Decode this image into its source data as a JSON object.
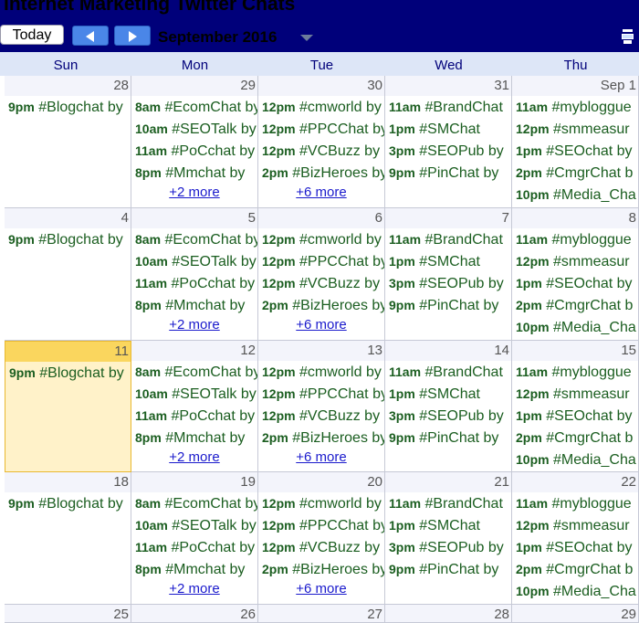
{
  "calendar": {
    "title": "Internet Marketing Twitter Chats",
    "today_label": "Today",
    "month_label": "September 2016",
    "day_names": [
      "Sun",
      "Mon",
      "Tue",
      "Wed",
      "Thu"
    ]
  },
  "weeks": [
    {
      "days": [
        {
          "num": "28",
          "today": false,
          "events": [
            {
              "time": "9pm",
              "title": "#Blogchat by"
            }
          ],
          "more": ""
        },
        {
          "num": "29",
          "today": false,
          "events": [
            {
              "time": "8am",
              "title": "#EcomChat by"
            },
            {
              "time": "10am",
              "title": "#SEOTalk by"
            },
            {
              "time": "11am",
              "title": "#PoCchat by"
            },
            {
              "time": "8pm",
              "title": "#Mmchat by"
            }
          ],
          "more": "+2 more"
        },
        {
          "num": "30",
          "today": false,
          "events": [
            {
              "time": "12pm",
              "title": "#cmworld by"
            },
            {
              "time": "12pm",
              "title": "#PPCChat by"
            },
            {
              "time": "12pm",
              "title": "#VCBuzz by"
            },
            {
              "time": "2pm",
              "title": "#BizHeroes by"
            }
          ],
          "more": "+6 more"
        },
        {
          "num": "31",
          "today": false,
          "events": [
            {
              "time": "11am",
              "title": "#BrandChat"
            },
            {
              "time": "1pm",
              "title": "#SMChat"
            },
            {
              "time": "3pm",
              "title": "#SEOPub by"
            },
            {
              "time": "9pm",
              "title": "#PinChat by"
            }
          ],
          "more": ""
        },
        {
          "num": "Sep 1",
          "today": false,
          "events": [
            {
              "time": "11am",
              "title": "#mybloggue"
            },
            {
              "time": "12pm",
              "title": "#smmeasur"
            },
            {
              "time": "1pm",
              "title": "#SEOchat by"
            },
            {
              "time": "2pm",
              "title": "#CmgrChat b"
            },
            {
              "time": "10pm",
              "title": "#Media_Cha"
            }
          ],
          "more": ""
        }
      ]
    },
    {
      "days": [
        {
          "num": "4",
          "today": false,
          "events": [
            {
              "time": "9pm",
              "title": "#Blogchat by"
            }
          ],
          "more": ""
        },
        {
          "num": "5",
          "today": false,
          "events": [
            {
              "time": "8am",
              "title": "#EcomChat by"
            },
            {
              "time": "10am",
              "title": "#SEOTalk by"
            },
            {
              "time": "11am",
              "title": "#PoCchat by"
            },
            {
              "time": "8pm",
              "title": "#Mmchat by"
            }
          ],
          "more": "+2 more"
        },
        {
          "num": "6",
          "today": false,
          "events": [
            {
              "time": "12pm",
              "title": "#cmworld by"
            },
            {
              "time": "12pm",
              "title": "#PPCChat by"
            },
            {
              "time": "12pm",
              "title": "#VCBuzz by"
            },
            {
              "time": "2pm",
              "title": "#BizHeroes by"
            }
          ],
          "more": "+6 more"
        },
        {
          "num": "7",
          "today": false,
          "events": [
            {
              "time": "11am",
              "title": "#BrandChat"
            },
            {
              "time": "1pm",
              "title": "#SMChat"
            },
            {
              "time": "3pm",
              "title": "#SEOPub by"
            },
            {
              "time": "9pm",
              "title": "#PinChat by"
            }
          ],
          "more": ""
        },
        {
          "num": "8",
          "today": false,
          "events": [
            {
              "time": "11am",
              "title": "#mybloggue"
            },
            {
              "time": "12pm",
              "title": "#smmeasur"
            },
            {
              "time": "1pm",
              "title": "#SEOchat by"
            },
            {
              "time": "2pm",
              "title": "#CmgrChat b"
            },
            {
              "time": "10pm",
              "title": "#Media_Cha"
            }
          ],
          "more": ""
        }
      ]
    },
    {
      "days": [
        {
          "num": "11",
          "today": true,
          "events": [
            {
              "time": "9pm",
              "title": "#Blogchat by"
            }
          ],
          "more": ""
        },
        {
          "num": "12",
          "today": false,
          "events": [
            {
              "time": "8am",
              "title": "#EcomChat by"
            },
            {
              "time": "10am",
              "title": "#SEOTalk by"
            },
            {
              "time": "11am",
              "title": "#PoCchat by"
            },
            {
              "time": "8pm",
              "title": "#Mmchat by"
            }
          ],
          "more": "+2 more"
        },
        {
          "num": "13",
          "today": false,
          "events": [
            {
              "time": "12pm",
              "title": "#cmworld by"
            },
            {
              "time": "12pm",
              "title": "#PPCChat by"
            },
            {
              "time": "12pm",
              "title": "#VCBuzz by"
            },
            {
              "time": "2pm",
              "title": "#BizHeroes by"
            }
          ],
          "more": "+6 more"
        },
        {
          "num": "14",
          "today": false,
          "events": [
            {
              "time": "11am",
              "title": "#BrandChat"
            },
            {
              "time": "1pm",
              "title": "#SMChat"
            },
            {
              "time": "3pm",
              "title": "#SEOPub by"
            },
            {
              "time": "9pm",
              "title": "#PinChat by"
            }
          ],
          "more": ""
        },
        {
          "num": "15",
          "today": false,
          "events": [
            {
              "time": "11am",
              "title": "#mybloggue"
            },
            {
              "time": "12pm",
              "title": "#smmeasur"
            },
            {
              "time": "1pm",
              "title": "#SEOchat by"
            },
            {
              "time": "2pm",
              "title": "#CmgrChat b"
            },
            {
              "time": "10pm",
              "title": "#Media_Cha"
            }
          ],
          "more": ""
        }
      ]
    },
    {
      "days": [
        {
          "num": "18",
          "today": false,
          "events": [
            {
              "time": "9pm",
              "title": "#Blogchat by"
            }
          ],
          "more": ""
        },
        {
          "num": "19",
          "today": false,
          "events": [
            {
              "time": "8am",
              "title": "#EcomChat by"
            },
            {
              "time": "10am",
              "title": "#SEOTalk by"
            },
            {
              "time": "11am",
              "title": "#PoCchat by"
            },
            {
              "time": "8pm",
              "title": "#Mmchat by"
            }
          ],
          "more": "+2 more"
        },
        {
          "num": "20",
          "today": false,
          "events": [
            {
              "time": "12pm",
              "title": "#cmworld by"
            },
            {
              "time": "12pm",
              "title": "#PPCChat by"
            },
            {
              "time": "12pm",
              "title": "#VCBuzz by"
            },
            {
              "time": "2pm",
              "title": "#BizHeroes by"
            }
          ],
          "more": "+6 more"
        },
        {
          "num": "21",
          "today": false,
          "events": [
            {
              "time": "11am",
              "title": "#BrandChat"
            },
            {
              "time": "1pm",
              "title": "#SMChat"
            },
            {
              "time": "3pm",
              "title": "#SEOPub by"
            },
            {
              "time": "9pm",
              "title": "#PinChat by"
            }
          ],
          "more": ""
        },
        {
          "num": "22",
          "today": false,
          "events": [
            {
              "time": "11am",
              "title": "#mybloggue"
            },
            {
              "time": "12pm",
              "title": "#smmeasur"
            },
            {
              "time": "1pm",
              "title": "#SEOchat by"
            },
            {
              "time": "2pm",
              "title": "#CmgrChat b"
            },
            {
              "time": "10pm",
              "title": "#Media_Cha"
            }
          ],
          "more": ""
        }
      ]
    },
    {
      "days": [
        {
          "num": "25",
          "today": false,
          "events": [],
          "more": ""
        },
        {
          "num": "26",
          "today": false,
          "events": [],
          "more": ""
        },
        {
          "num": "27",
          "today": false,
          "events": [],
          "more": ""
        },
        {
          "num": "28",
          "today": false,
          "events": [],
          "more": ""
        },
        {
          "num": "29",
          "today": false,
          "events": [],
          "more": ""
        }
      ]
    }
  ]
}
